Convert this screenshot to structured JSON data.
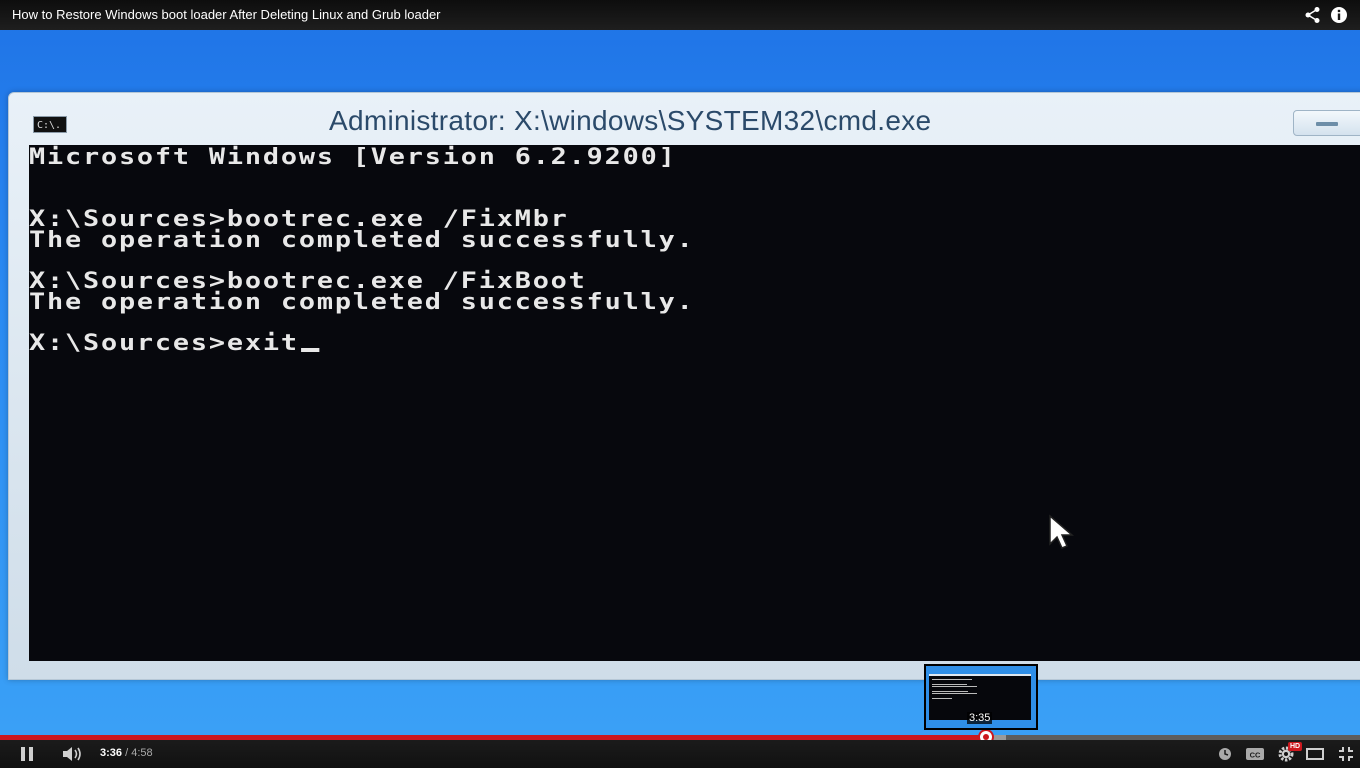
{
  "video": {
    "title": "How to Restore Windows boot loader After Deleting Linux and Grub loader"
  },
  "cmd": {
    "window_title": "Administrator: X:\\windows\\SYSTEM32\\cmd.exe",
    "icon_text": "C:\\.",
    "lines": [
      "Microsoft Windows [Version 6.2.9200]",
      "",
      "X:\\Sources>bootrec.exe /FixMbr",
      "The operation completed successfully.",
      "",
      "X:\\Sources>bootrec.exe /FixBoot",
      "The operation completed successfully.",
      "",
      "X:\\Sources>exit"
    ]
  },
  "preview": {
    "time": "3:35"
  },
  "controls": {
    "current_time": "3:36",
    "separator": " / ",
    "duration": "4:58",
    "progress_fraction": 0.7248,
    "loaded_fraction": 0.74,
    "hd_label": "HD"
  },
  "colors": {
    "progress_played": "#cc181e",
    "desktop_blue": "#2a8af2",
    "console_bg": "#07080d"
  },
  "icons": [
    "share-icon",
    "info-icon",
    "cmd-icon",
    "minimize-icon",
    "mouse-pointer-icon",
    "pause-icon",
    "volume-icon",
    "watch-later-icon",
    "captions-icon",
    "settings-icon",
    "theater-icon",
    "fullscreen-icon"
  ]
}
